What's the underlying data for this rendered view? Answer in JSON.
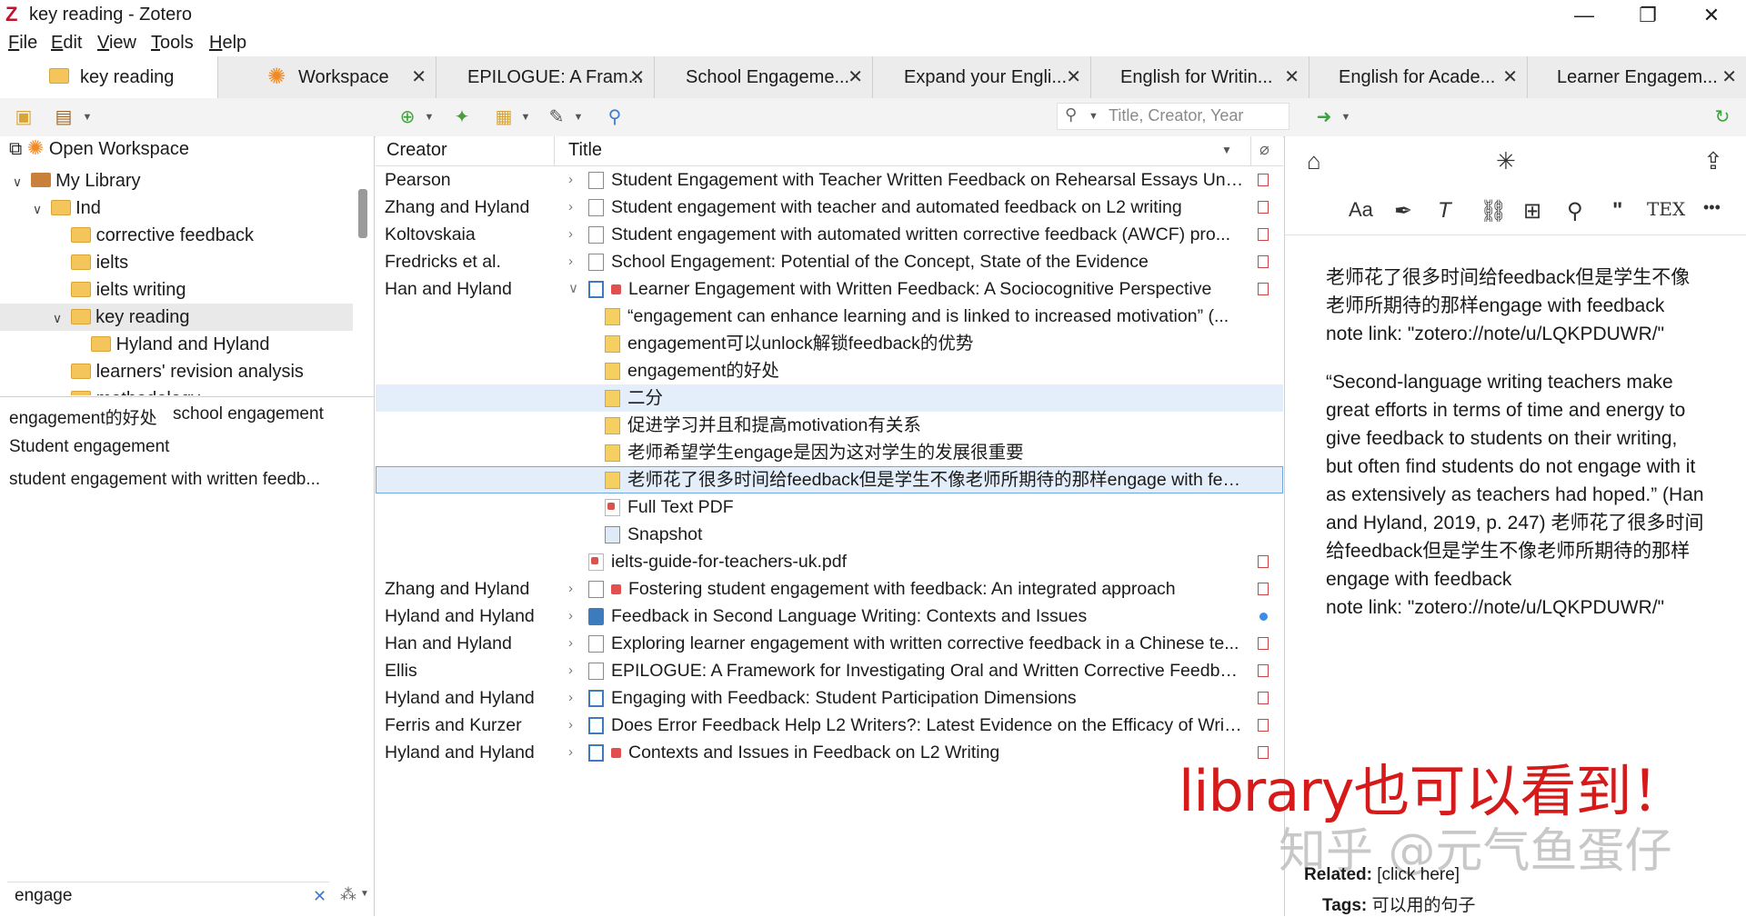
{
  "window": {
    "title": "key reading - Zotero",
    "minimize": "—",
    "maximize": "❐",
    "close": "✕"
  },
  "menu": [
    "File",
    "Edit",
    "View",
    "Tools",
    "Help"
  ],
  "tabs": [
    {
      "label": "key reading"
    },
    {
      "label": "Workspace"
    },
    {
      "label": "EPILOGUE: A Fram..."
    },
    {
      "label": "School Engageme..."
    },
    {
      "label": "Expand your Engli..."
    },
    {
      "label": "English for Writin..."
    },
    {
      "label": "English for Acade..."
    },
    {
      "label": "Learner Engagem..."
    }
  ],
  "search": {
    "placeholder": "Title, Creator, Year"
  },
  "collections": {
    "open_workspace": "Open Workspace",
    "items": [
      {
        "label": "My Library"
      },
      {
        "label": "Ind"
      },
      {
        "label": "corrective feedback"
      },
      {
        "label": "ielts"
      },
      {
        "label": "ielts writing"
      },
      {
        "label": "key reading"
      },
      {
        "label": "Hyland and Hyland"
      },
      {
        "label": "learners' revision analysis"
      },
      {
        "label": "methodology"
      }
    ]
  },
  "tags": [
    "engagement的好处",
    "school engagement",
    "Student engagement",
    "student engagement with written feedb..."
  ],
  "tag_filter": {
    "value": "engage"
  },
  "columns": {
    "creator": "Creator",
    "title": "Title"
  },
  "items": [
    {
      "creator": "Pearson",
      "title": "Student Engagement with Teacher Written Feedback on Rehearsal Essays Und..."
    },
    {
      "creator": "Zhang and Hyland",
      "title": "Student engagement with teacher and automated feedback on L2 writing"
    },
    {
      "creator": "Koltovskaia",
      "title": "Student engagement with automated written corrective feedback (AWCF) pro..."
    },
    {
      "creator": "Fredricks et al.",
      "title": "School Engagement: Potential of the Concept, State of the Evidence"
    },
    {
      "creator": "Han and Hyland",
      "title": "Learner Engagement with Written Feedback: A Sociocognitive Perspective"
    },
    {
      "creator": "",
      "title": "“engagement can enhance learning and is linked to increased motivation” (..."
    },
    {
      "creator": "",
      "title": "engagement可以unlock解锁feedback的优势"
    },
    {
      "creator": "",
      "title": "engagement的好处"
    },
    {
      "creator": "",
      "title": "二分"
    },
    {
      "creator": "",
      "title": "促进学习并且和提高motivation有关系"
    },
    {
      "creator": "",
      "title": "老师希望学生engage是因为这对学生的发展很重要"
    },
    {
      "creator": "",
      "title": "老师花了很多时间给feedback但是学生不像老师所期待的那样engage with feedb..."
    },
    {
      "creator": "",
      "title": "Full Text PDF"
    },
    {
      "creator": "",
      "title": "Snapshot"
    },
    {
      "creator": "",
      "title": "ielts-guide-for-teachers-uk.pdf"
    },
    {
      "creator": "Zhang and Hyland",
      "title": "Fostering student engagement with feedback: An integrated approach"
    },
    {
      "creator": "Hyland and Hyland",
      "title": "Feedback in Second Language Writing: Contexts and Issues"
    },
    {
      "creator": "Han and Hyland",
      "title": "Exploring learner engagement with written corrective feedback in a Chinese te..."
    },
    {
      "creator": "Ellis",
      "title": "EPILOGUE: A Framework for Investigating Oral and Written Corrective Feedback"
    },
    {
      "creator": "Hyland and Hyland",
      "title": "Engaging with Feedback: Student Participation Dimensions"
    },
    {
      "creator": "Ferris and Kurzer",
      "title": "Does Error Feedback Help L2 Writers?: Latest Evidence on the Efficacy of Writt..."
    },
    {
      "creator": "Hyland and Hyland",
      "title": "Contexts and Issues in Feedback on L2 Writing"
    }
  ],
  "note": {
    "para1": "老师花了很多时间给feedback但是学生不像老师所期待的那样engage with feedback",
    "para1_link": "note link: \"zotero://note/u/LQKPDUWR/\"",
    "para2": "“Second-language writing teachers make great efforts in terms of time and energy to give feedback to students on their writing, but often find students do not engage with it as extensively as teachers had hoped.” (Han and Hyland, 2019, p. 247) 老师花了很多时间给feedback但是学生不像老师所期待的那样engage with feedback",
    "para2_link": "note link: \"zotero://note/u/LQKPDUWR/\"",
    "related_label": "Related:",
    "related_value": "[click here]",
    "tags_label": "Tags:",
    "tags_value": "可以用的句子"
  },
  "format_bar": {
    "text_size": "Aa",
    "quote": "\"",
    "tex": "TEX",
    "more": "•••"
  },
  "overlay": {
    "text": "library也可以看到！",
    "watermark": "知乎 @元气鱼蛋仔",
    "color": "#d61a1a"
  }
}
